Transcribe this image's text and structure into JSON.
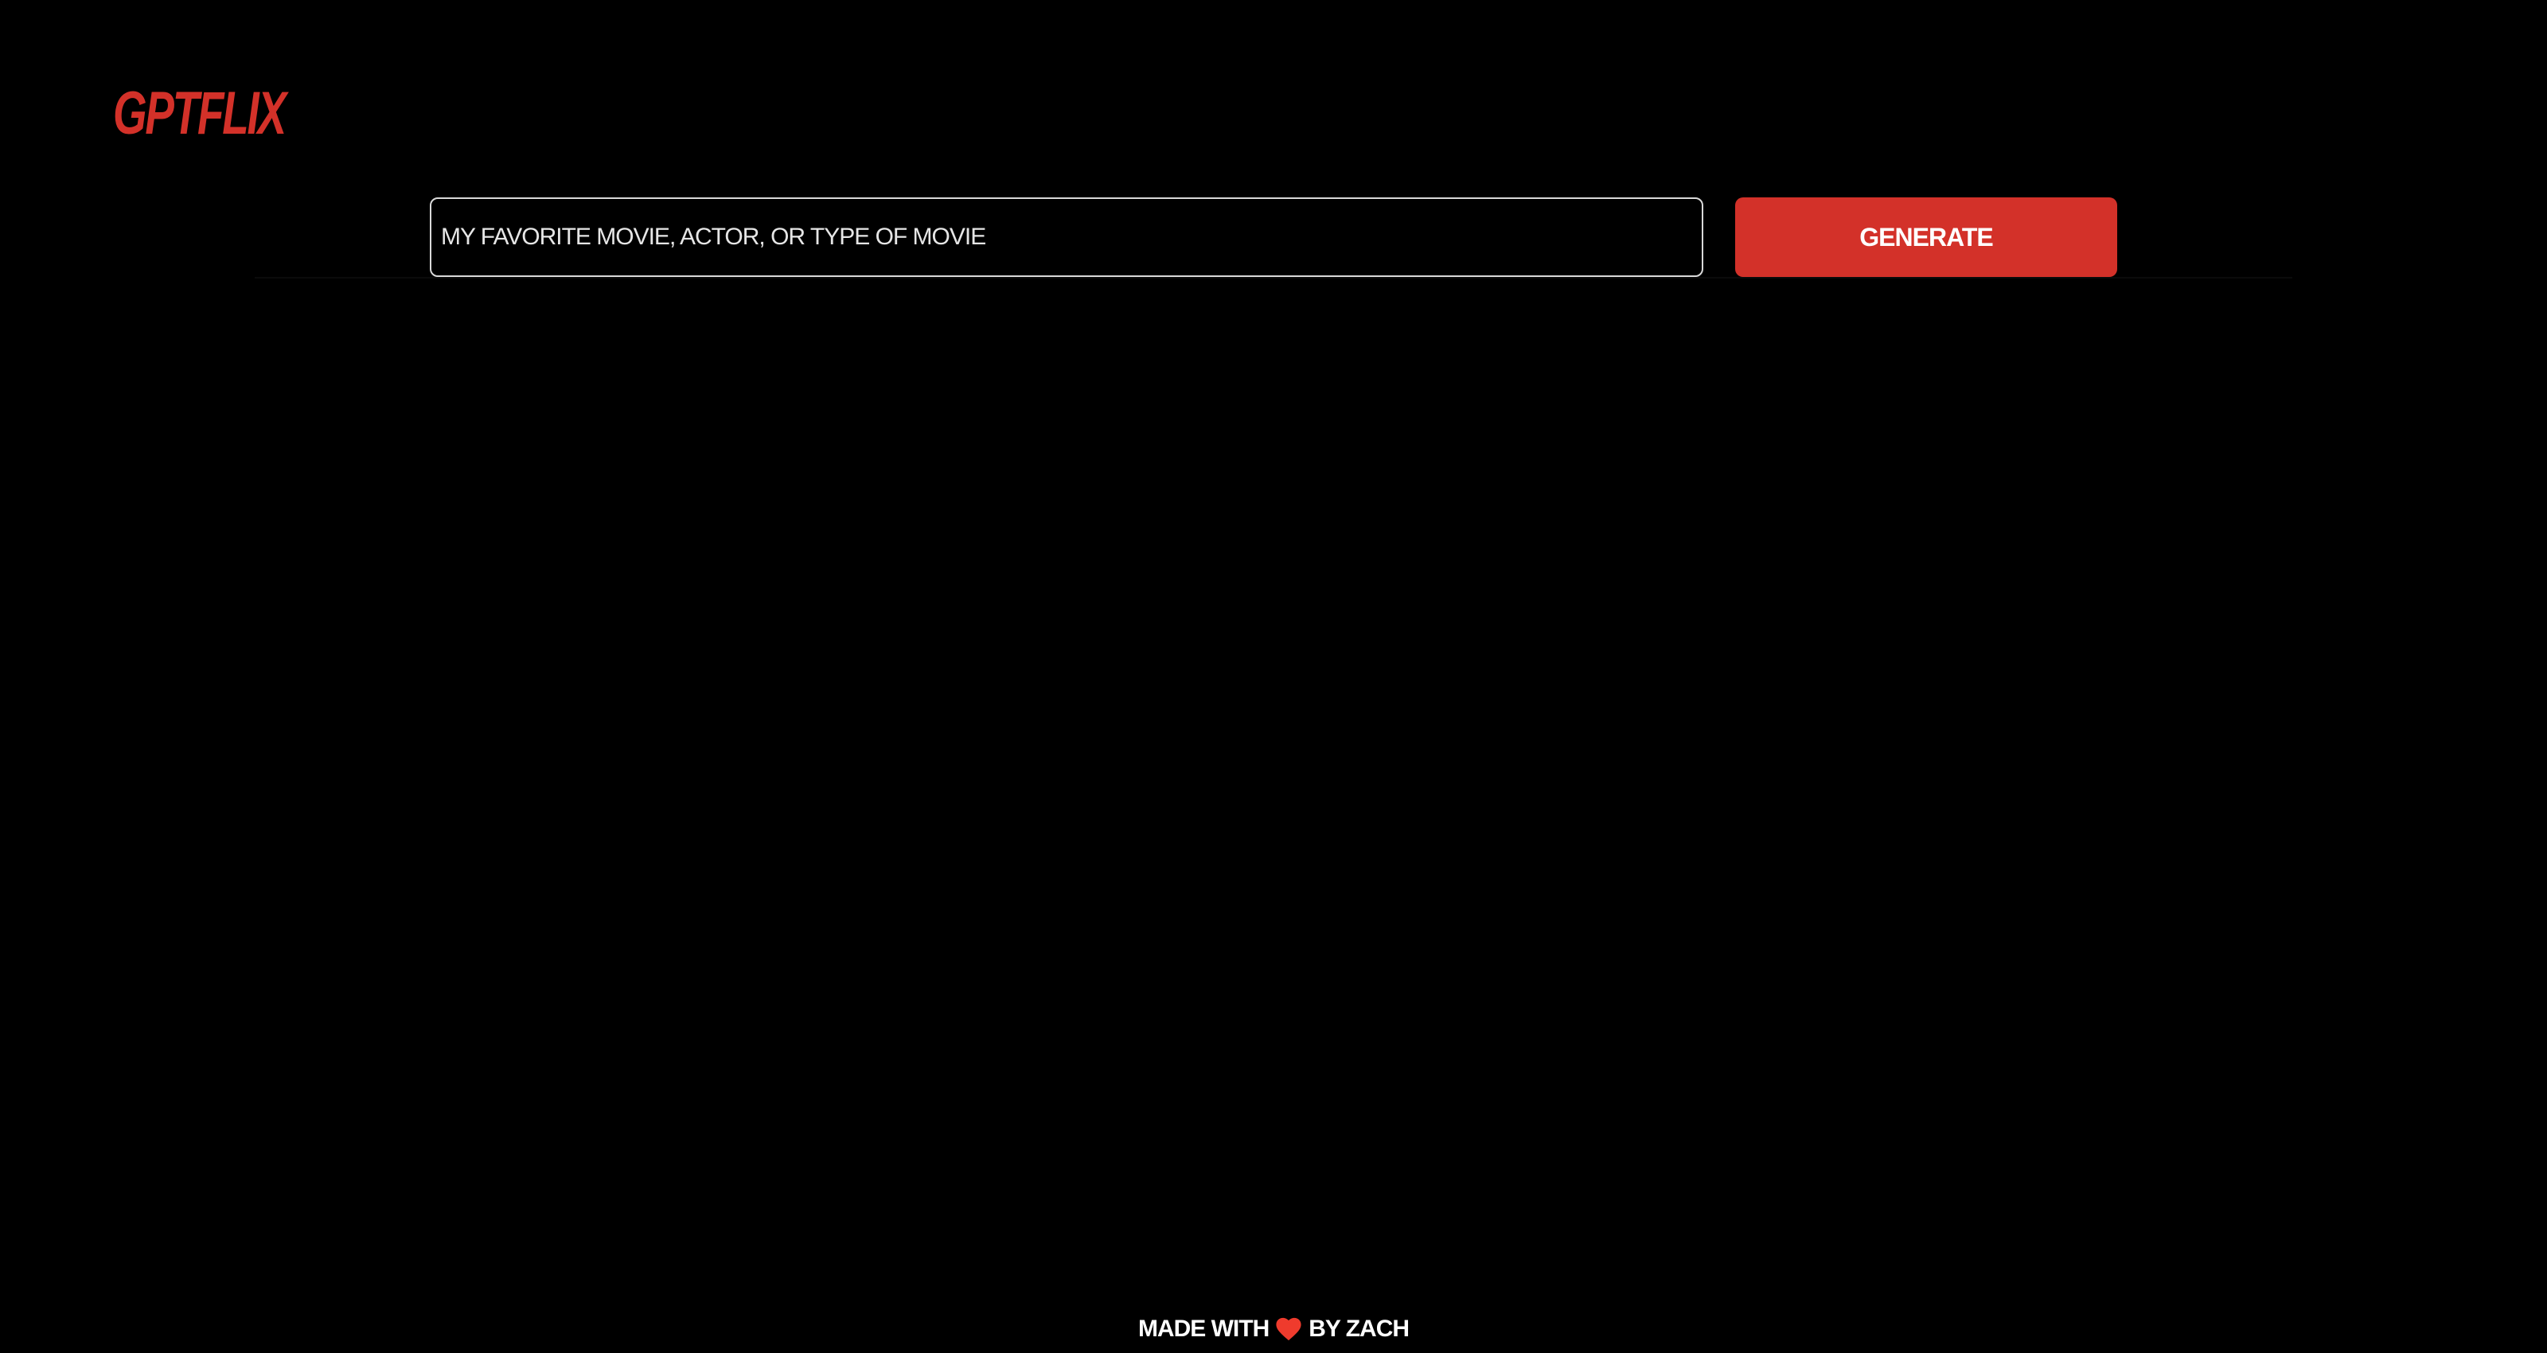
{
  "app": {
    "logo_text": "GPTFLIX",
    "brand_color": "#d33129"
  },
  "search": {
    "placeholder": "MY FAVORITE MOVIE, ACTOR, OR TYPE OF MOVIE",
    "value": ""
  },
  "actions": {
    "generate_label": "GENERATE",
    "generate_color": "#d33129"
  },
  "footer": {
    "prefix": "MADE WITH",
    "icon": "heart-icon",
    "heart_color": "#ef3b2d",
    "suffix": "BY ZACH"
  }
}
